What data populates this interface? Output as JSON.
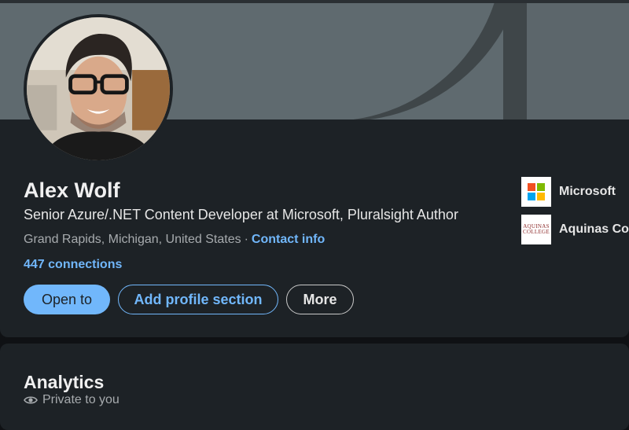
{
  "profile": {
    "name": "Alex Wolf",
    "headline": "Senior Azure/.NET Content Developer at Microsoft, Pluralsight Author",
    "location": "Grand Rapids, Michigan, United States",
    "separator": "·",
    "contact_label": "Contact info",
    "connections": "447 connections"
  },
  "actions": {
    "open_to": "Open to",
    "add_section": "Add profile section",
    "more": "More"
  },
  "organizations": [
    {
      "name": "Microsoft",
      "logo": "microsoft-logo"
    },
    {
      "name": "Aquinas Col",
      "logo": "aquinas-college-logo",
      "logo_text": [
        "AQUINAS",
        "COLLEGE"
      ]
    }
  ],
  "analytics": {
    "title": "Analytics",
    "visibility": "Private to you",
    "visibility_icon": "eye-icon"
  },
  "colors": {
    "background": "#1d2226",
    "accent": "#71b7fb",
    "cover": "#5f6a6f"
  }
}
